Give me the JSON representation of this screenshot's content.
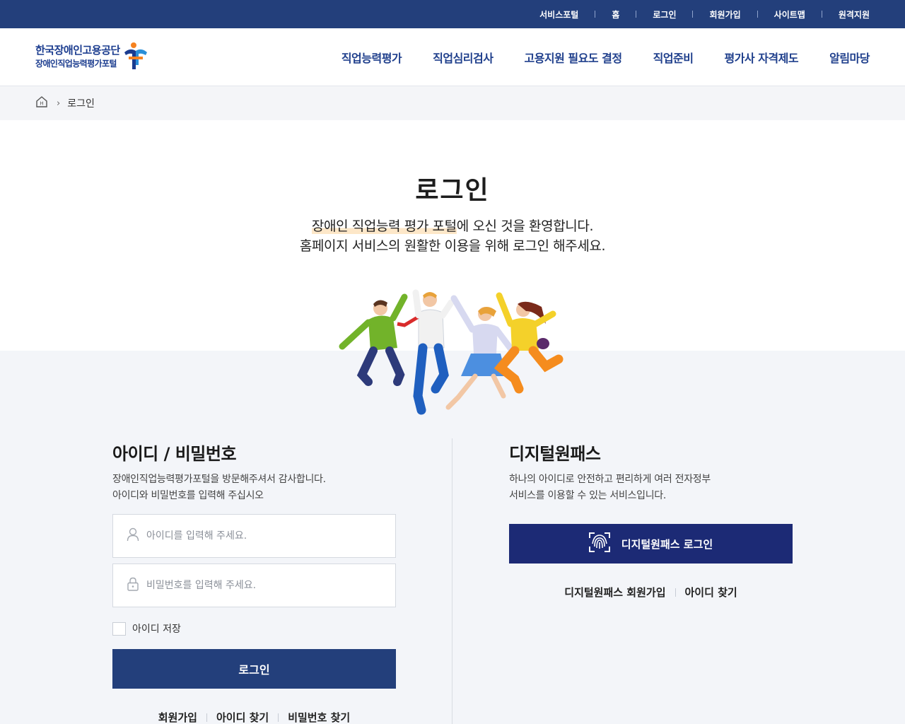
{
  "utility": [
    "서비스포털",
    "홈",
    "로그인",
    "회원가입",
    "사이트맵",
    "원격지원"
  ],
  "logo": {
    "main": "한국장애인고용공단",
    "sub": "장애인직업능력평가포털"
  },
  "nav": [
    "직업능력평가",
    "직업심리검사",
    "고용지원 필요도 결정",
    "직업준비",
    "평가사 자격제도",
    "알림마당"
  ],
  "breadcrumb": {
    "home_icon_letter": "H",
    "current": "로그인"
  },
  "hero": {
    "title": "로그인",
    "line1_highlight": "장애인 직업능력 평가 포털",
    "line1_rest": "에 오신 것을 환영합니다.",
    "line2": "홈페이지 서비스의 원활한 이용을 위해 로그인 해주세요."
  },
  "id_login": {
    "title": "아이디 / 비밀번호",
    "desc1": "장애인직업능력평가포털을 방문해주셔서 감사합니다.",
    "desc2": "아이디와 비밀번호를 입력해 주십시오",
    "id_placeholder": "아이디를 입력해 주세요.",
    "pw_placeholder": "비밀번호를 입력해 주세요.",
    "save_label": "아이디 저장",
    "login_button": "로그인",
    "links": [
      "회원가입",
      "아이디 찾기",
      "비밀번호 찾기"
    ]
  },
  "digital_pass": {
    "title": "디지털원패스",
    "desc1": "하나의 아이디로 안전하고 편리하게 여러 전자정부",
    "desc2": "서비스를 이용할 수 있는 서비스입니다.",
    "button": "디지털원패스 로그인",
    "links": [
      "디지털원패스 회원가입",
      "아이디 찾기"
    ]
  },
  "colors": {
    "navy": "#233f7b",
    "dp_navy": "#1c2a75",
    "accent_orange": "#f58220"
  }
}
